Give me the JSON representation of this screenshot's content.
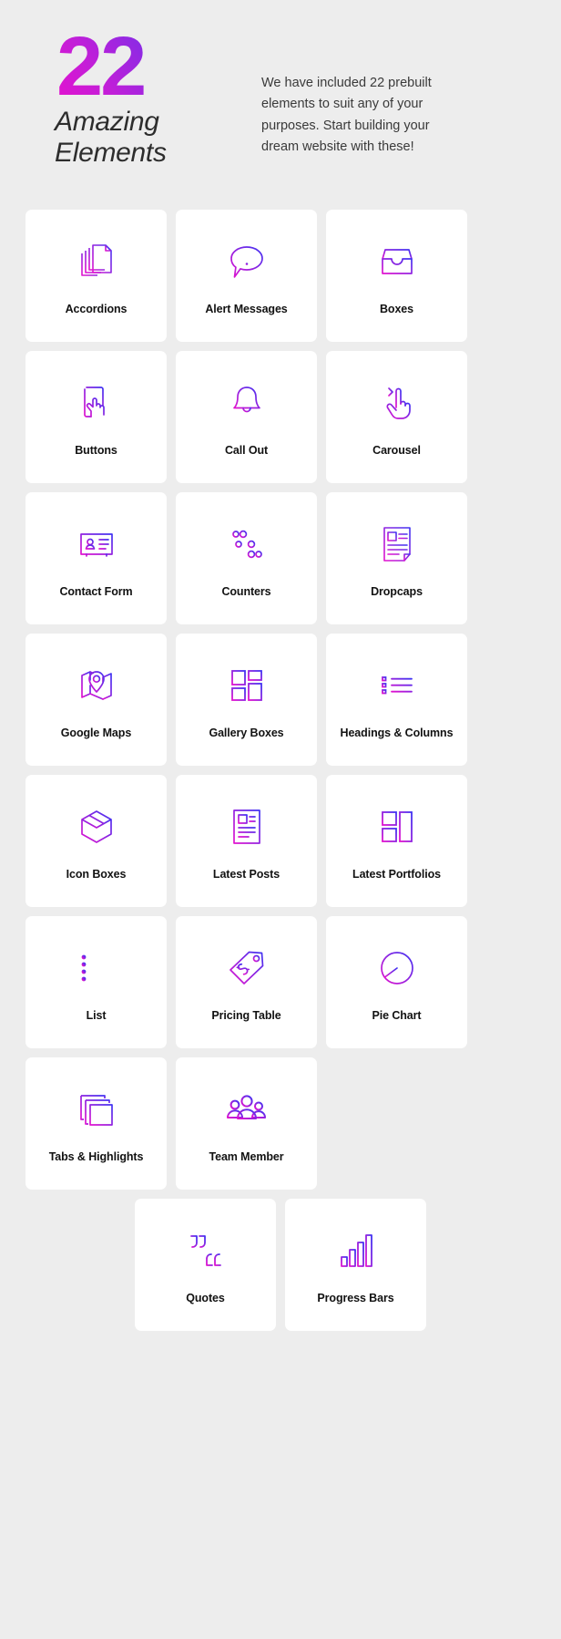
{
  "hero": {
    "number": "22",
    "subtitle": "Amazing\nElements",
    "description": "We have included 22 prebuilt elements to suit any of your purposes. Start building your dream website with these!"
  },
  "theme": {
    "background": "#ededed",
    "card_background": "#ffffff",
    "label_color": "#121212",
    "gradient_start": "#e312cf",
    "gradient_end": "#3f33f2"
  },
  "cards": [
    {
      "label": "Accordions",
      "icon": "stacked-documents-icon"
    },
    {
      "label": "Alert Messages",
      "icon": "speech-bubble-exclamation-icon"
    },
    {
      "label": "Boxes",
      "icon": "open-tray-box-icon"
    },
    {
      "label": "Buttons",
      "icon": "phone-tap-hand-icon"
    },
    {
      "label": "Call Out",
      "icon": "bell-icon"
    },
    {
      "label": "Carousel",
      "icon": "swipe-hand-arrow-icon"
    },
    {
      "label": "Contact Form",
      "icon": "id-card-person-icon"
    },
    {
      "label": "Counters",
      "icon": "sliders-icon"
    },
    {
      "label": "Dropcaps",
      "icon": "document-letter-a-icon"
    },
    {
      "label": "Google Maps",
      "icon": "folded-map-pin-icon"
    },
    {
      "label": "Gallery Boxes",
      "icon": "grid-blocks-icon"
    },
    {
      "label": "Headings & Columns",
      "icon": "bullet-lines-icon"
    },
    {
      "label": "Icon Boxes",
      "icon": "cube-box-icon"
    },
    {
      "label": "Latest Posts",
      "icon": "article-thumbnail-icon"
    },
    {
      "label": "Latest Portfolios",
      "icon": "layout-blocks-icon"
    },
    {
      "label": "List",
      "icon": "bullet-list-icon"
    },
    {
      "label": "Pricing Table",
      "icon": "price-tag-icon"
    },
    {
      "label": "Pie Chart",
      "icon": "pie-chart-icon"
    },
    {
      "label": "Tabs & Highlights",
      "icon": "stacked-squares-icon"
    },
    {
      "label": "Team Member",
      "icon": "people-group-icon"
    },
    {
      "label": "Quotes",
      "icon": "quotation-marks-icon"
    },
    {
      "label": "Progress Bars",
      "icon": "bar-chart-icon"
    }
  ]
}
